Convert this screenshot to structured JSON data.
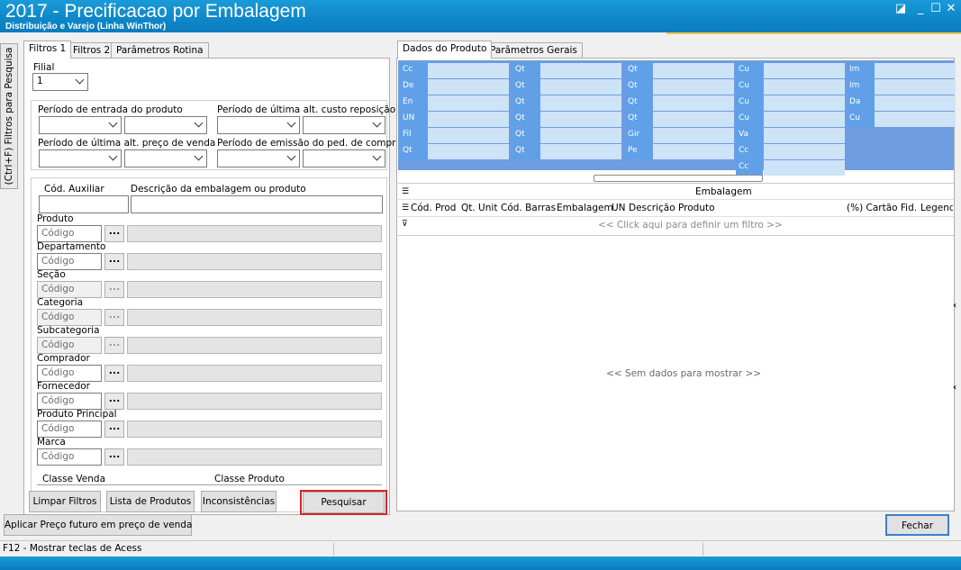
{
  "window": {
    "title": "2017 - Precificacao por Embalagem",
    "subtitle": "Distribuição e Varejo (Linha WinThor)",
    "controls": {
      "restore": "◪",
      "minimize": "_",
      "maximize": "☐",
      "close": "✕"
    }
  },
  "side_tab": {
    "label": "(Ctrl+F) Filtros para Pesquisa"
  },
  "left_tabs": [
    {
      "label": "Filtros 1"
    },
    {
      "label": "Filtros 2"
    },
    {
      "label": "Parâmetros Rotina"
    }
  ],
  "filters": {
    "filial_label": "Filial",
    "filial_value": "1",
    "periods": {
      "entrada": "Período de entrada do produto",
      "ultima_alt_custo": "Período de última alt. custo reposição",
      "ultima_alt_preco": "Período de última alt. preço de venda",
      "emissao_ped": "Período de emissão do ped. de compra"
    },
    "cod_auxiliar_label": "Cód. Auxiliar",
    "descricao_label": "Descrição da embalagem ou produto",
    "code_placeholder": "Código",
    "fields": [
      {
        "label": "Produto"
      },
      {
        "label": "Departamento"
      },
      {
        "label": "Seção"
      },
      {
        "label": "Categoria"
      },
      {
        "label": "Subcategoria"
      },
      {
        "label": "Comprador"
      },
      {
        "label": "Fornecedor"
      },
      {
        "label": "Produto Principal"
      },
      {
        "label": "Marca"
      }
    ],
    "classe_venda": "Classe Venda",
    "classe_produto": "Classe Produto",
    "dots": "..."
  },
  "left_buttons": {
    "limpar": "Limpar Filtros",
    "lista": "Lista de Produtos",
    "inconsistencias": "Inconsistências",
    "pesquisar": "Pesquisar"
  },
  "right_tabs": [
    {
      "label": "Dados do Produto"
    },
    {
      "label": "Parâmetros Gerais"
    }
  ],
  "product_cells": {
    "col1": [
      "Cc",
      "De",
      "En",
      "UN",
      "Fil",
      "Qt"
    ],
    "col2": [
      "Qt",
      "Qt",
      "Qt",
      "Qt",
      "Qt",
      "Qt"
    ],
    "col3": [
      "Qt",
      "Qt",
      "Qt",
      "Qt",
      "Gir",
      "Pe"
    ],
    "col4": [
      "Cu",
      "Cu",
      "Cu",
      "Cu",
      "Va",
      "Cc",
      "Cc"
    ],
    "col5": [
      "Im",
      "Im",
      "Da",
      "Cu"
    ]
  },
  "grid": {
    "band_title": "Embalagem",
    "columns": [
      "Cód. Prod",
      "Qt. Unit",
      "Cód. Barras",
      "Embalagem",
      "UN",
      "Descrição Produto",
      "(%) Cartão Fid.",
      "Legend"
    ],
    "filter_row": "<< Click aqui para definir um filtro >>",
    "empty": "<< Sem dados para mostrar >>"
  },
  "bottom": {
    "aplicar": "Aplicar Preço futuro em preço de venda",
    "fechar": "Fechar"
  },
  "status": {
    "text": "F12 - Mostrar teclas de Acess"
  }
}
